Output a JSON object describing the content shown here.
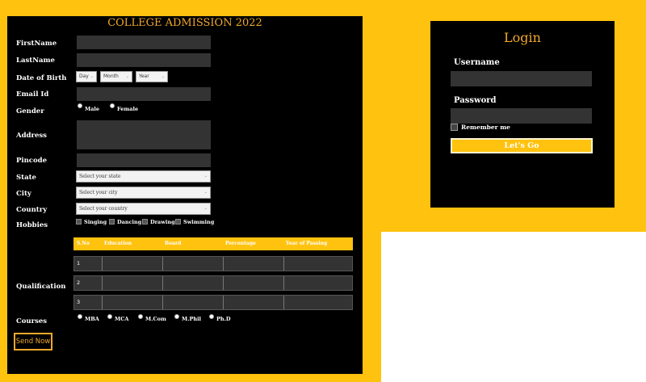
{
  "admission": {
    "title": "COLLEGE ADMISSION 2022",
    "labels": {
      "first_name": "FirstName",
      "last_name": "LastName",
      "dob": "Date of Birth",
      "email": "Email Id",
      "gender": "Gender",
      "address": "Address",
      "pincode": "Pincode",
      "state": "State",
      "city": "City",
      "country": "Country",
      "hobbies": "Hobbies",
      "qualification": "Qualification",
      "courses": "Courses"
    },
    "dob": {
      "day": "Day",
      "month": "Month",
      "year": "Year"
    },
    "gender_options": [
      "Male",
      "Female"
    ],
    "state_select": "Select your state",
    "city_select": "Select your city",
    "country_select": "Select your country",
    "hobbies": [
      "Singing",
      "Dancing",
      "Drawing",
      "Swimming"
    ],
    "qualification_headers": [
      "S.No",
      "Education",
      "Board",
      "Percentage",
      "Year of Passing"
    ],
    "qualification_rows": [
      "1",
      "2",
      "3"
    ],
    "courses": [
      "MBA",
      "MCA",
      "M.Com",
      "M.Phil",
      "Ph.D"
    ],
    "send_button": "Send Now"
  },
  "login": {
    "title": "Login",
    "username_label": "Username",
    "password_label": "Password",
    "remember_label": "Remember me",
    "submit_button": "Let's Go"
  },
  "colors": {
    "accent": "#ffc20e",
    "title_gold": "#f0a82c",
    "panel": "#000000",
    "field": "#333333"
  }
}
